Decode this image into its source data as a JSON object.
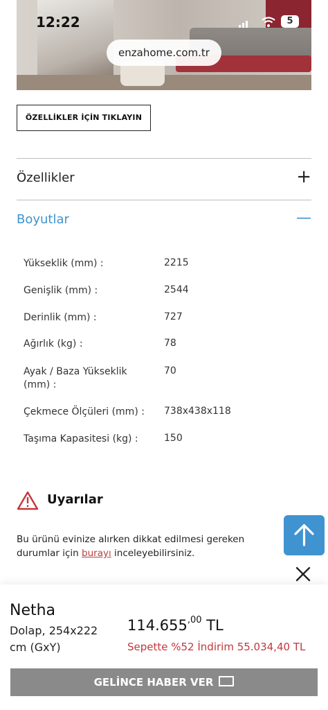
{
  "status_bar": {
    "time": "12:22",
    "battery": "5"
  },
  "hero": {
    "url": "enzahome.com.tr"
  },
  "features_button": "ÖZELLİKLER İÇİN TIKLAYIN",
  "accordions": [
    {
      "label": "Özellikler",
      "icon": "+"
    },
    {
      "label": "Boyutlar",
      "icon": "—"
    }
  ],
  "specs": [
    {
      "key": "Yükseklik (mm) :",
      "value": "2215"
    },
    {
      "key": "Genişlik (mm) :",
      "value": "2544"
    },
    {
      "key": "Derinlik (mm) :",
      "value": "727"
    },
    {
      "key": "Ağırlık (kg) :",
      "value": "78"
    },
    {
      "key": "Ayak / Baza Yükseklik (mm) :",
      "value": "70"
    },
    {
      "key": "Çekmece Ölçüleri (mm) :",
      "value": "738x438x118"
    },
    {
      "key": "Taşıma Kapasitesi (kg) :",
      "value": "150"
    }
  ],
  "warnings": {
    "title": "Uyarılar",
    "text_before": "Bu ürünü evinize alırken dikkat edilmesi gereken durumlar için ",
    "link": "burayı",
    "text_after": " inceleyebilirsiniz."
  },
  "product": {
    "name": "Netha",
    "description": "Dolap, 254x222 cm (GxY)",
    "price_main": "114.655",
    "price_decimals": ",00",
    "currency": "TL",
    "discount": "Sepette %52 İndirim 55.034,40 TL",
    "notify_button": "GELİNCE HABER VER"
  },
  "colors": {
    "accent_blue": "#3f93d0",
    "discount_red": "#c2373b",
    "notify_gray": "#8a8a8a"
  }
}
